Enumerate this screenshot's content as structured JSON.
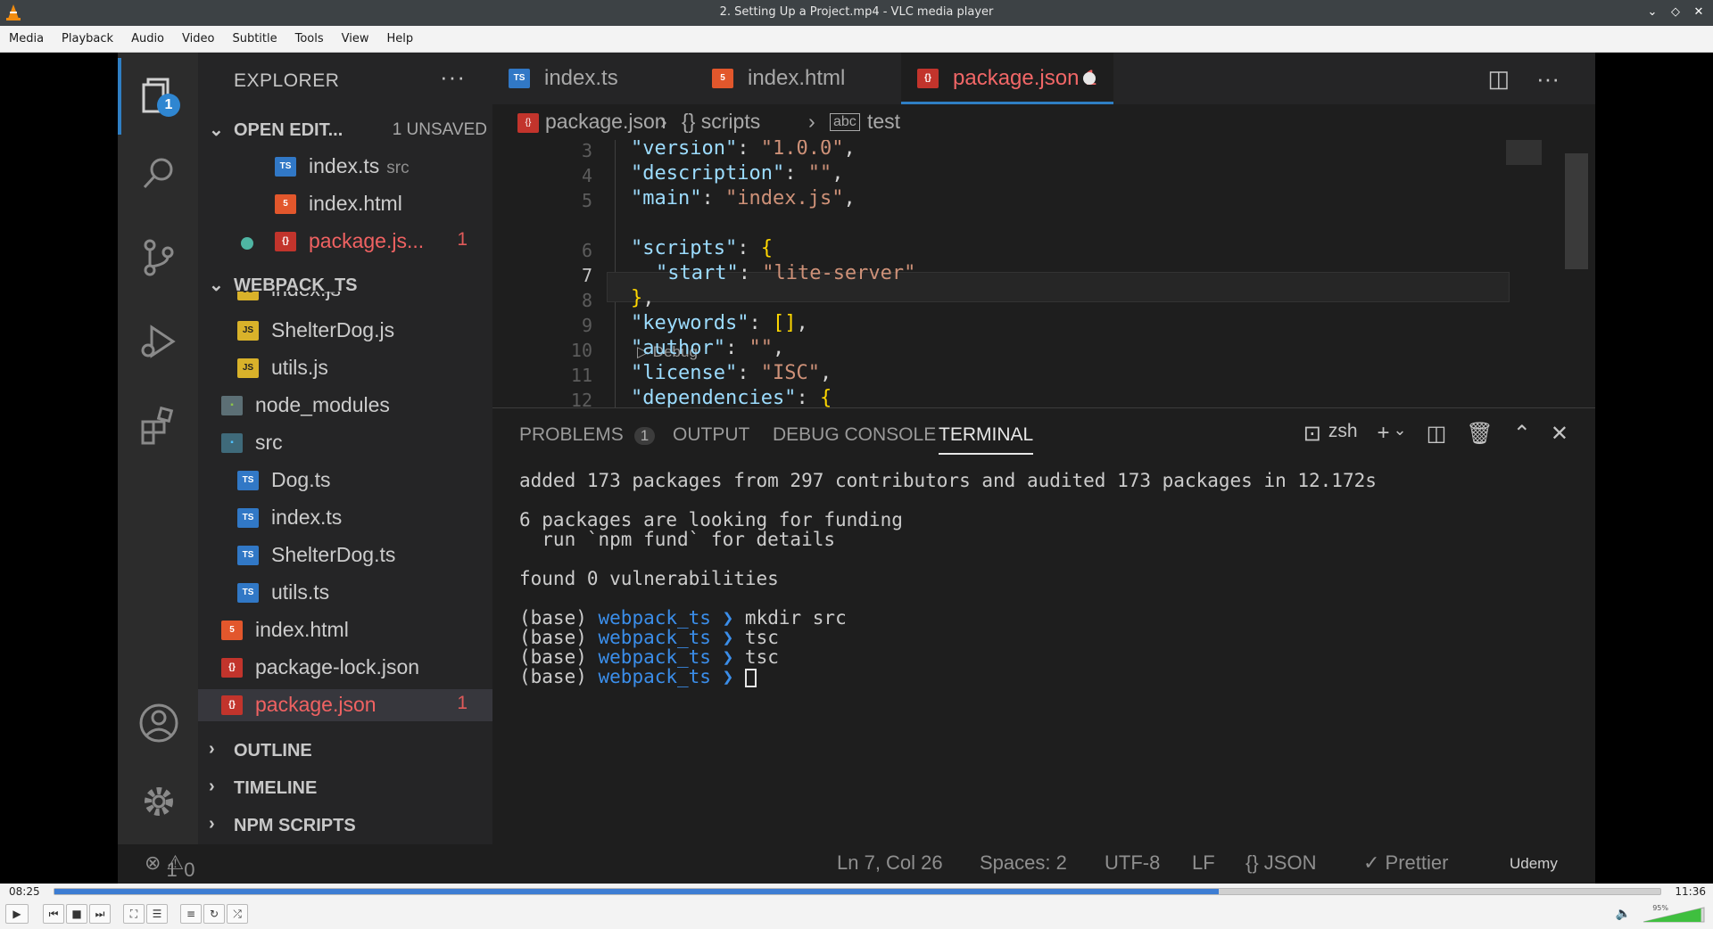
{
  "window": {
    "title": "2. Setting Up a Project.mp4 - VLC media player",
    "controls": [
      "⌄",
      "◇",
      "✕"
    ]
  },
  "menu": [
    "Media",
    "Playback",
    "Audio",
    "Video",
    "Subtitle",
    "Tools",
    "View",
    "Help"
  ],
  "explorer": {
    "header": "EXPLORER",
    "open_editors": {
      "label": "OPEN EDIT...",
      "unsaved": "1 UNSAVED",
      "items": [
        {
          "name": "index.ts",
          "sub": "src",
          "icon": "TS"
        },
        {
          "name": "index.html",
          "icon": "5"
        },
        {
          "name": "package.js...",
          "count": "1",
          "icon": "{}"
        }
      ]
    },
    "project": {
      "label": "WEBPACK_TS",
      "items": [
        {
          "name": "index.js",
          "icon": "JS"
        },
        {
          "name": "ShelterDog.js",
          "icon": "JS"
        },
        {
          "name": "utils.js",
          "icon": "JS"
        },
        {
          "name": "node_modules",
          "icon": "▪"
        },
        {
          "name": "src",
          "icon": "▪"
        },
        {
          "name": "Dog.ts",
          "icon": "TS"
        },
        {
          "name": "index.ts",
          "icon": "TS"
        },
        {
          "name": "ShelterDog.ts",
          "icon": "TS"
        },
        {
          "name": "utils.ts",
          "icon": "TS"
        },
        {
          "name": "index.html",
          "icon": "5"
        },
        {
          "name": "package-lock.json",
          "icon": "{}"
        },
        {
          "name": "package.json",
          "count": "1",
          "icon": "{}"
        }
      ]
    },
    "outline": "OUTLINE",
    "timeline": "TIMELINE",
    "npm_scripts": "NPM SCRIPTS",
    "activity_badge": "1"
  },
  "tabs": [
    {
      "name": "index.ts",
      "icon": "TS"
    },
    {
      "name": "index.html",
      "icon": "5"
    },
    {
      "name": "package.json 1",
      "icon": "{}"
    }
  ],
  "breadcrumb": [
    "package.json",
    "{} scripts",
    "test"
  ],
  "code": {
    "lines": [
      {
        "n": "3",
        "key": "\"version\"",
        "val": "\"1.0.0\"",
        "tail": ","
      },
      {
        "n": "4",
        "key": "\"description\"",
        "val": "\"\"",
        "tail": ","
      },
      {
        "n": "5",
        "key": "\"main\"",
        "val": "\"index.js\"",
        "tail": ","
      },
      {
        "n": "6",
        "key": "\"scripts\"",
        "val": "{",
        "tail": ""
      },
      {
        "n": "7",
        "key": "\"start\"",
        "val": "\"lite-server\"",
        "tail": ""
      },
      {
        "n": "8",
        "key": "",
        "val": "}",
        "tail": ","
      },
      {
        "n": "9",
        "key": "\"keywords\"",
        "val": "[]",
        "tail": ","
      },
      {
        "n": "10",
        "key": "\"author\"",
        "val": "\"\"",
        "tail": ","
      },
      {
        "n": "11",
        "key": "\"license\"",
        "val": "\"ISC\"",
        "tail": ","
      },
      {
        "n": "12",
        "key": "\"dependencies\"",
        "val": "{",
        "tail": ""
      }
    ],
    "codelens": "▷ Debug"
  },
  "panel": {
    "tabs": [
      "PROBLEMS",
      "OUTPUT",
      "DEBUG CONSOLE",
      "TERMINAL"
    ],
    "problems_count": "1",
    "shell": "zsh",
    "terminal": [
      "added 173 packages from 297 contributors and audited 173 packages in 12.172s",
      "",
      "6 packages are looking for funding",
      "  run `npm fund` for details",
      "",
      "found 0 vulnerabilities",
      ""
    ],
    "prompts": [
      {
        "base": "(base)",
        "dir": "webpack_ts",
        "arrow": "❯",
        "cmd": "mkdir src"
      },
      {
        "base": "(base)",
        "dir": "webpack_ts",
        "arrow": "❯",
        "cmd": "tsc"
      },
      {
        "base": "(base)",
        "dir": "webpack_ts",
        "arrow": "❯",
        "cmd": "tsc"
      },
      {
        "base": "(base)",
        "dir": "webpack_ts",
        "arrow": "❯",
        "cmd": ""
      }
    ]
  },
  "status": {
    "errors": "1",
    "warnings": "0",
    "position": "Ln 7, Col 26",
    "spaces": "Spaces: 2",
    "encoding": "UTF-8",
    "eol": "LF",
    "language": "{} JSON",
    "formatter": "✓ Prettier",
    "watermark": "Udemy"
  },
  "player": {
    "elapsed": "08:25",
    "total": "11:36",
    "progress": 0.725,
    "volume": "95%",
    "volume_level": 0.95
  },
  "colors": {
    "accent": "#3d7dd3",
    "error": "#f06262"
  }
}
